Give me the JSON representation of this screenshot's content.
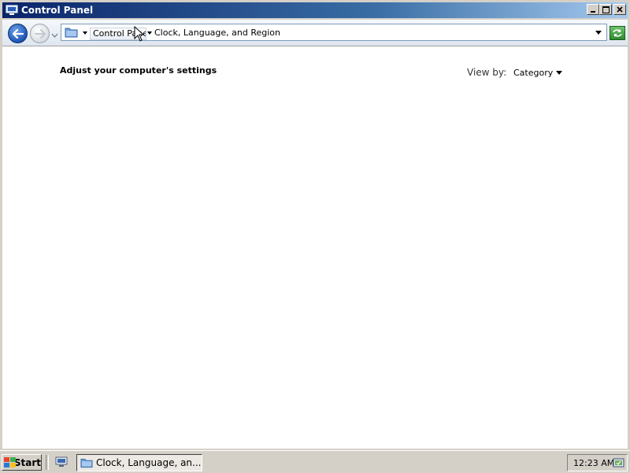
{
  "window": {
    "title": "Control Panel",
    "buttons": {
      "minimize": "_",
      "maximize": "□",
      "close": "X"
    }
  },
  "navbar": {
    "breadcrumbs": [
      "Control Panel",
      "Clock, Language, and Region"
    ]
  },
  "content": {
    "heading": "Adjust your computer's settings",
    "view_by_label": "View by:",
    "view_by_value": "Category"
  },
  "taskbar": {
    "start_label": "Start",
    "task_button_label": "Clock, Language, an...",
    "clock": "12:23 AM"
  },
  "icons": {
    "title": "computer-icon",
    "back": "back-arrow-icon",
    "forward": "forward-arrow-icon",
    "folder": "folder-icon",
    "refresh": "refresh-icon",
    "start": "windows-flag-icon",
    "quick_launch": "show-desktop-icon",
    "tray": "network-icon"
  },
  "colors": {
    "titlebar_start": "#0a246a",
    "titlebar_end": "#a6caf0",
    "back_button": "#1d56b8",
    "refresh_button": "#2f8a2f"
  }
}
